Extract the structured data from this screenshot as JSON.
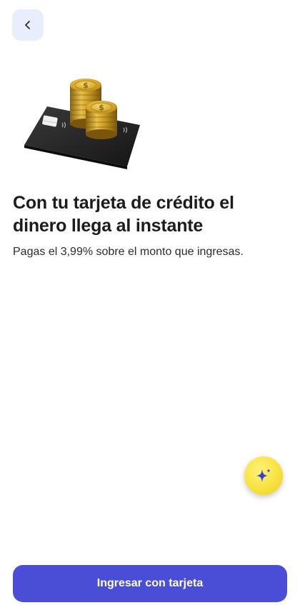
{
  "header": {
    "back_icon": "chevron-left-icon"
  },
  "hero": {
    "image": "card-with-gold-coins",
    "coin_symbol": "$"
  },
  "content": {
    "headline": "Con tu tarjeta de crédito el dinero llega al instante",
    "description": "Pagas el 3,99% sobre el monto que ingresas."
  },
  "assistant": {
    "icon": "sparkle-icon"
  },
  "actions": {
    "primary_label": "Ingresar con tarjeta"
  },
  "colors": {
    "primary": "#4a4ed6",
    "back_button_bg": "#e9eefc",
    "assistant_bg": "#f7e23f",
    "sparkle": "#3b3fc7",
    "coin_gold": "#d4a52a",
    "card": "#262626"
  }
}
